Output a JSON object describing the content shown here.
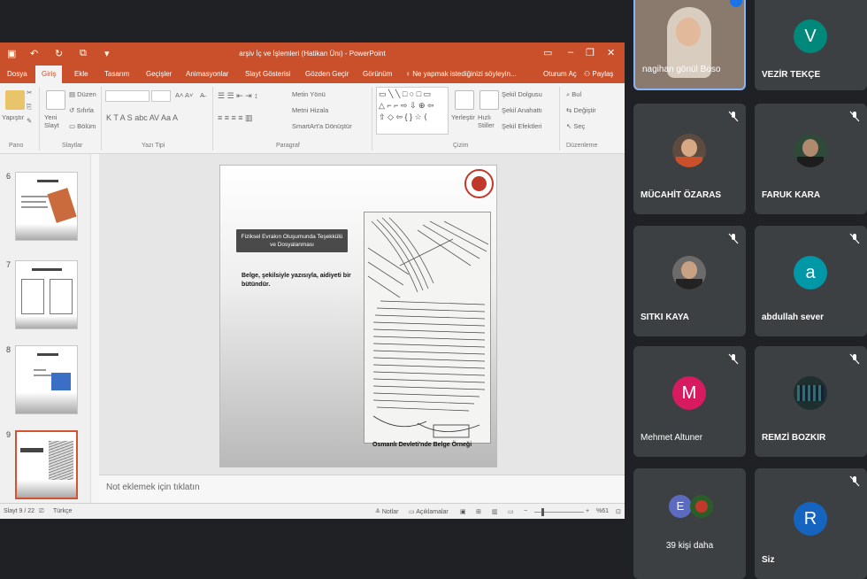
{
  "powerpoint": {
    "doc_title": "arşiv İç ve İşlemleri (Hatikan Ünı) - PowerPoint",
    "tabs": [
      "Dosya",
      "Giriş",
      "Ekle",
      "Tasarım",
      "Geçişler",
      "Animasyonlar",
      "Slayt Gösterisi",
      "Gözden Geçir",
      "Görünüm"
    ],
    "active_tab": "Giriş",
    "search_text": "Ne yapmak istediğinizi söyleyin...",
    "sign_in": "Oturum Aç",
    "share": "Paylaş",
    "ribbon": {
      "paste": "Yapıştır",
      "new_slide": "Yeni Slayt",
      "layout": "Düzen",
      "reset": "Sıfırla",
      "section": "Bölüm",
      "text_direction": "Metin Yönü",
      "align_text": "Metni Hizala",
      "smartart": "SmartArt'a Dönüştür",
      "arrange": "Yerleştir",
      "quick_styles": "Hızlı Stiller",
      "shape_fill": "Şekil Dolgusu",
      "shape_outline": "Şekil Anahattı",
      "shape_effects": "Şekil Efektleri",
      "find": "Bul",
      "replace": "Değiştir",
      "select": "Seç",
      "groups": {
        "clipboard": "Pano",
        "slides": "Slaytlar",
        "font": "Yazı Tipi",
        "paragraph": "Paragraf",
        "drawing": "Çizim",
        "editing": "Düzenleme"
      }
    },
    "thumbnails": [
      {
        "num": "6"
      },
      {
        "num": "7"
      },
      {
        "num": "8"
      },
      {
        "num": "9",
        "selected": true
      }
    ],
    "slide": {
      "title_line1": "Fiziksel Evrakın Oluşumunda Teşekkülü",
      "title_line2": "ve Dosyalanması",
      "body": "Belge, şekilsiyle yazısıyla, aidiyeti bir bütündür.",
      "caption": "Osmanlı Devleti'nde Belge Örneği"
    },
    "notes_placeholder": "Not eklemek için tıklatın",
    "status": {
      "slide_info": "Slayt 9 / 22",
      "language": "Türkçe",
      "notes": "Notlar",
      "comments": "Açıklamalar",
      "zoom": "%61"
    }
  },
  "participants": [
    {
      "name": "nagihan gönül Boso",
      "type": "photo",
      "muted": false,
      "active": true
    },
    {
      "name": "VEZİR TEKÇE",
      "type": "letter",
      "letter": "V",
      "color": "#00897b",
      "muted": false
    },
    {
      "name": "MÜCAHİT ÖZARAS",
      "type": "photo",
      "muted": true
    },
    {
      "name": "FARUK KARA",
      "type": "photo",
      "muted": true
    },
    {
      "name": "SITKI KAYA",
      "type": "photo",
      "muted": true
    },
    {
      "name": "abdullah sever",
      "type": "letter",
      "letter": "a",
      "color": "#0097a7",
      "muted": true
    },
    {
      "name": "Mehmet Altuner",
      "type": "letter",
      "letter": "M",
      "color": "#d81b60",
      "muted": true
    },
    {
      "name": "REMZİ BOZKIR",
      "type": "photo",
      "muted": true
    },
    {
      "name": "39 kişi daha",
      "type": "group",
      "letter": "E",
      "color": "#5c6bc0",
      "muted": false
    },
    {
      "name": "Siz",
      "type": "letter",
      "letter": "R",
      "color": "#1565c0",
      "muted": true
    }
  ]
}
